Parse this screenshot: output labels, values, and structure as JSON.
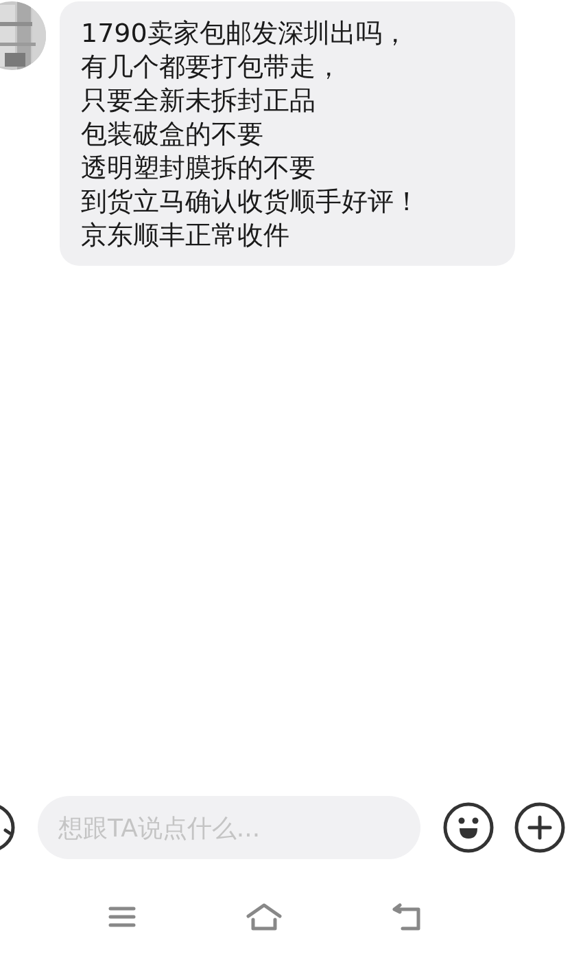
{
  "messages": [
    {
      "lines": [
        "1790卖家包邮发深圳出吗，",
        "有几个都要打包带走，",
        "只要全新未拆封正品",
        "包装破盒的不要",
        "透明塑封膜拆的不要",
        "到货立马确认收货顺手好评！",
        "京东顺丰正常收件"
      ]
    }
  ],
  "composer": {
    "placeholder": "想跟TA说点什么..."
  }
}
